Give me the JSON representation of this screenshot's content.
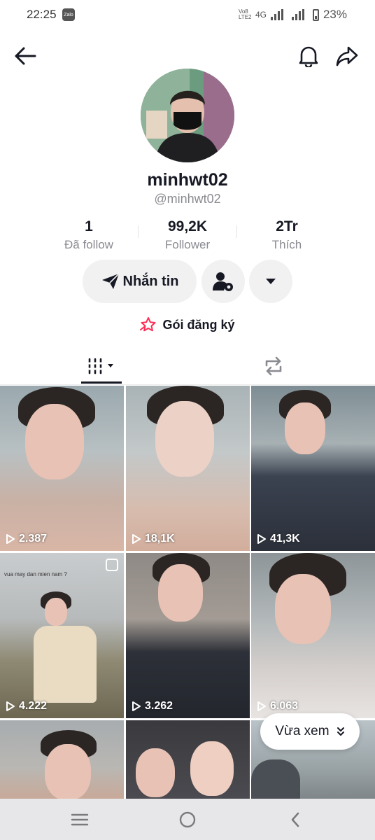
{
  "status_bar": {
    "time": "22:25",
    "zalo_label": "Zalo",
    "network_top": "Vo8 LTE2",
    "network_type": "4G",
    "battery": "23%"
  },
  "profile": {
    "display_name": "minhwt02",
    "handle": "@minhwt02"
  },
  "stats": [
    {
      "value": "1",
      "label": "Đã follow"
    },
    {
      "value": "99,2K",
      "label": "Follower"
    },
    {
      "value": "2Tr",
      "label": "Thích"
    }
  ],
  "actions": {
    "message_label": "Nhắn tin"
  },
  "subscription": {
    "label": "Gói đăng ký"
  },
  "videos": [
    {
      "views": "2.387"
    },
    {
      "views": "18,1K"
    },
    {
      "views": "41,3K"
    },
    {
      "views": "4.222",
      "caption": "vua may dan mien nam ?"
    },
    {
      "views": "3.262"
    },
    {
      "views": "6.063"
    }
  ],
  "recently_viewed": {
    "label": "Vừa xem"
  },
  "colors": {
    "accent_pink": "#fe2c55",
    "text_primary": "#161823",
    "text_secondary": "#8a8b91",
    "button_bg": "#f1f1f2"
  }
}
